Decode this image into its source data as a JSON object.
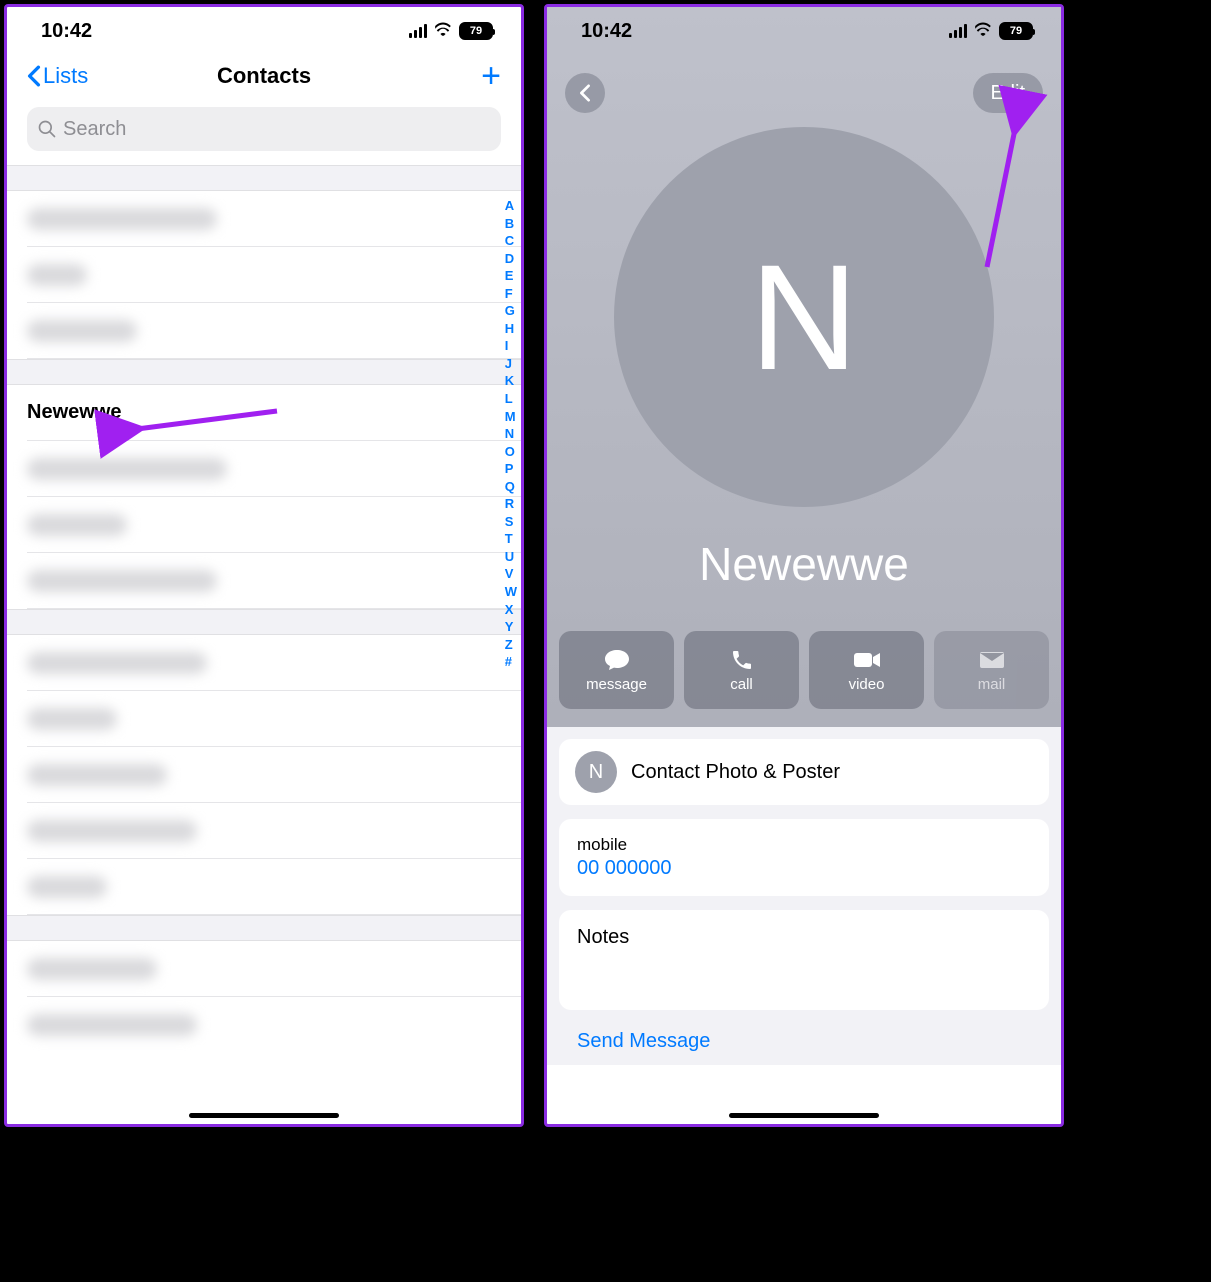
{
  "status": {
    "time": "10:42",
    "battery": "79"
  },
  "left": {
    "back_label": "Lists",
    "title": "Contacts",
    "search_placeholder": "Search",
    "highlight_contact": "Newewwe",
    "alpha": [
      "A",
      "B",
      "C",
      "D",
      "E",
      "F",
      "G",
      "H",
      "I",
      "J",
      "K",
      "L",
      "M",
      "N",
      "O",
      "P",
      "Q",
      "R",
      "S",
      "T",
      "U",
      "V",
      "W",
      "X",
      "Y",
      "Z",
      "#"
    ]
  },
  "right": {
    "edit_label": "Edit",
    "avatar_initial": "N",
    "contact_name": "Newewwe",
    "actions": {
      "message": "message",
      "call": "call",
      "video": "video",
      "mail": "mail"
    },
    "photo_row": "Contact Photo & Poster",
    "mini_initial": "N",
    "phone_label": "mobile",
    "phone_value": "00 000000",
    "notes_label": "Notes",
    "send_message": "Send Message"
  }
}
